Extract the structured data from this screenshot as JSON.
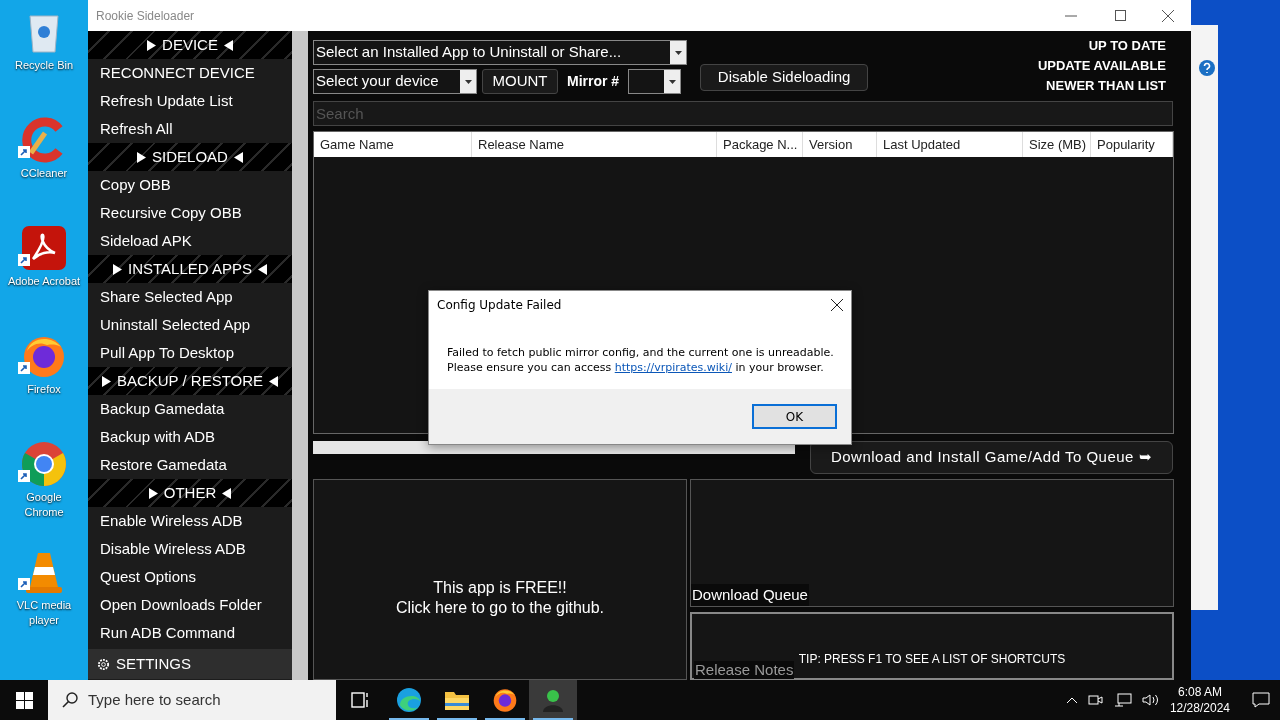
{
  "desktop": {
    "icons": [
      {
        "kind": "recycle",
        "label": "Recycle Bin",
        "shortcut": false
      },
      {
        "kind": "ccleaner",
        "label": "CCleaner",
        "shortcut": true
      },
      {
        "kind": "acrobat",
        "label": "Adobe Acrobat",
        "shortcut": true
      },
      {
        "kind": "firefox",
        "label": "Firefox",
        "shortcut": true
      },
      {
        "kind": "chrome",
        "label": "Google Chrome",
        "shortcut": true
      },
      {
        "kind": "vlc",
        "label": "VLC media player",
        "shortcut": true
      }
    ]
  },
  "window": {
    "title": "Rookie Sideloader"
  },
  "sidebar": {
    "sections": [
      {
        "title": "DEVICE",
        "items": [
          "RECONNECT DEVICE",
          "Refresh Update List",
          "Refresh All"
        ]
      },
      {
        "title": "SIDELOAD",
        "items": [
          "Copy OBB",
          "Recursive Copy OBB",
          "Sideload APK"
        ]
      },
      {
        "title": "INSTALLED APPS",
        "items": [
          "Share Selected App",
          "Uninstall Selected App",
          "Pull App To Desktop"
        ]
      },
      {
        "title": "BACKUP / RESTORE",
        "items": [
          "Backup Gamedata",
          "Backup with ADB",
          "Restore Gamedata"
        ]
      },
      {
        "title": "OTHER",
        "items": [
          "Enable Wireless ADB",
          "Disable Wireless ADB",
          "Quest Options",
          "Open Downloads Folder",
          "Run ADB Command"
        ]
      }
    ],
    "settings": "SETTINGS"
  },
  "toolbar": {
    "installed_app_select": "Select an Installed App to Uninstall or Share...",
    "device_select": "Select your device",
    "mount_button": "MOUNT",
    "mirror_label": "Mirror #",
    "disable_button": "Disable Sideloading"
  },
  "status_legend": [
    "UP TO DATE",
    "UPDATE AVAILABLE",
    "NEWER THAN LIST"
  ],
  "search": {
    "placeholder": "Search"
  },
  "table": {
    "columns": [
      "Game Name",
      "Release Name",
      "Package N...",
      "Version",
      "Last Updated",
      "Size (MB)",
      "Popularity"
    ]
  },
  "progress": {
    "level": 1
  },
  "download_button": "Download and Install Game/Add To Queue ➥",
  "promo": {
    "lines": [
      "This app is FREE!!",
      "Click here to go to the github."
    ]
  },
  "download_queue": {
    "label": "Download Queue"
  },
  "release_notes": {
    "label": "Release Notes",
    "tip": "TIP: PRESS F1 TO SEE A LIST OF SHORTCUTS"
  },
  "dialog": {
    "title": "Config Update Failed",
    "line1": "Failed to fetch public mirror config, and the current one is unreadable.",
    "line2_before": "Please ensure you can access ",
    "link": "https://vrpirates.wiki/",
    "line2_after": " in your browser.",
    "ok": "OK"
  },
  "taskbar": {
    "search_placeholder": "Type here to search",
    "apps": [
      {
        "kind": "taskview",
        "running": false,
        "selected": false
      },
      {
        "kind": "edge",
        "running": true,
        "selected": false
      },
      {
        "kind": "explorer",
        "running": true,
        "selected": false
      },
      {
        "kind": "firefox",
        "running": true,
        "selected": false
      },
      {
        "kind": "rookie",
        "running": true,
        "selected": true
      }
    ],
    "time": "6:08 AM",
    "date": "12/28/2024"
  }
}
